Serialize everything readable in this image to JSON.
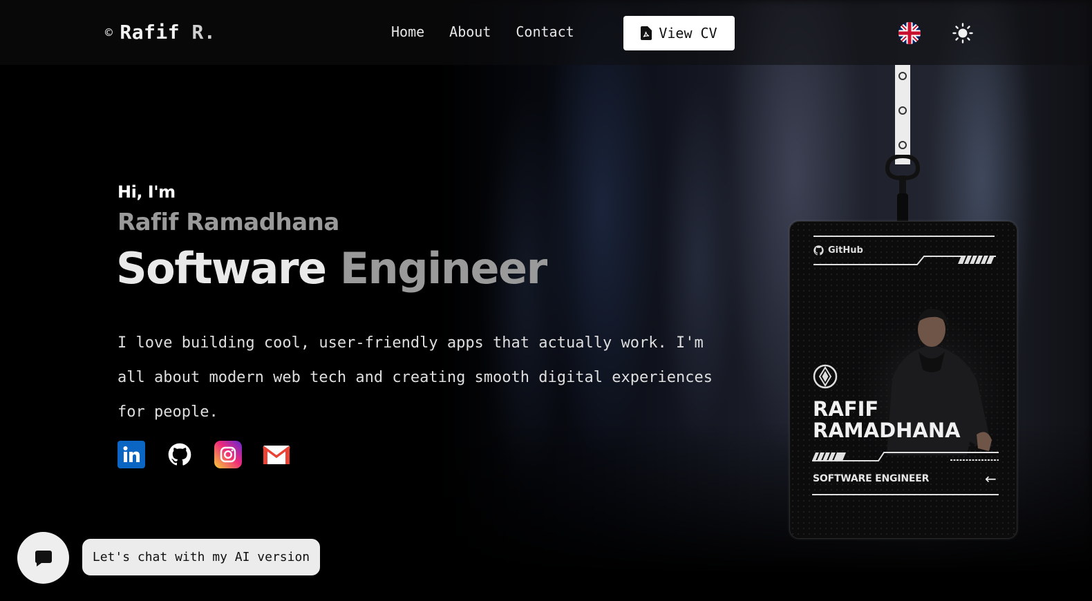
{
  "header": {
    "logo_symbol": "©",
    "logo_first": "Rafif",
    "logo_last": "R.",
    "nav": [
      "Home",
      "About",
      "Contact"
    ],
    "cv_button": "View CV",
    "language_icon": "uk-flag-icon",
    "theme_icon": "sun-icon"
  },
  "hero": {
    "greeting": "Hi, I'm",
    "name": "Rafif Ramadhana",
    "role_word1": "Software",
    "role_word2": "Engineer",
    "description": "I love building cool, user-friendly apps that actually work. I'm all about modern web tech and creating smooth digital experiences for people.",
    "socials": [
      "linkedin-icon",
      "github-icon",
      "instagram-icon",
      "gmail-icon"
    ]
  },
  "badge": {
    "brand": "GitHub",
    "name_line1": "RAFIF",
    "name_line2": "RAMADHANA",
    "role": "SOFTWARE ENGINEER",
    "arrow": "←"
  },
  "chat": {
    "label": "Let's chat with my AI version"
  },
  "colors": {
    "accent_white": "#ffffff",
    "muted_gray": "#9a9a9a",
    "linkedin": "#0a66c2"
  }
}
